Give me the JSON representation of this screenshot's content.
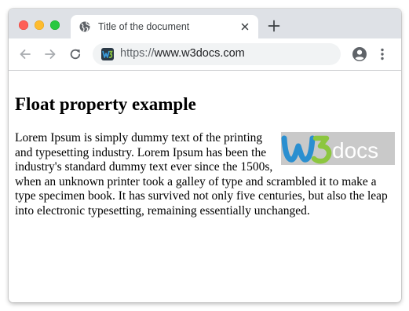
{
  "browser": {
    "tab": {
      "title": "Title of the document",
      "icon": "globe-icon"
    },
    "address_bar": {
      "scheme": "https://",
      "host": "www.w3docs.com",
      "site_icon": "w3docs-favicon"
    },
    "colors": {
      "tabstrip": "#dee1e6",
      "close": "#fe5f57",
      "minimize": "#febc2e",
      "zoom": "#28c840"
    }
  },
  "page": {
    "heading": "Float property example",
    "paragraph": "Lorem Ipsum is simply dummy text of the printing and typesetting industry. Lorem Ipsum has been the industry's standard dummy text ever since the 1500s, when an unknown printer took a galley of type and scrambled it to make a type specimen book. It has survived not only five centuries, but also the leap into electronic typesetting, remaining essentially unchanged.",
    "logo": {
      "text": "docs",
      "colors": {
        "w_blue": "#2a8fd0",
        "three_green": "#8cc63f",
        "docs_text": "#ffffff",
        "background": "#c9c9c9"
      }
    }
  }
}
